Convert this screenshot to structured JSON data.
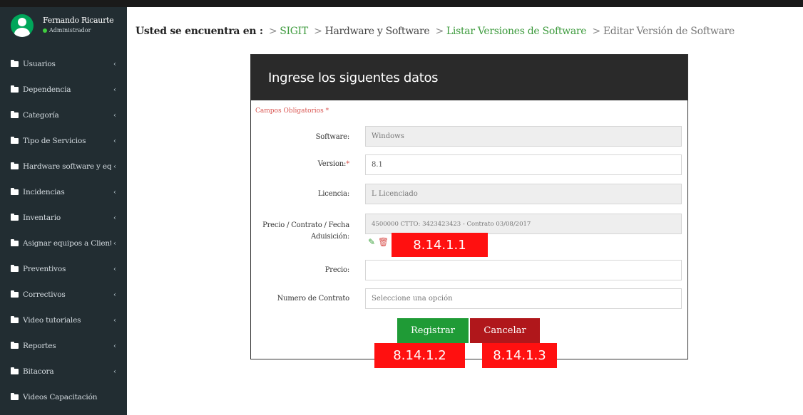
{
  "user": {
    "name": "Fernando Ricaurte",
    "role": "Administrador"
  },
  "sidebar": {
    "items": [
      {
        "label": "Usuarios"
      },
      {
        "label": "Dependencia"
      },
      {
        "label": "Categoría"
      },
      {
        "label": "Tipo de Servicios"
      },
      {
        "label": "Hardware software y equipo"
      },
      {
        "label": "Incidencias"
      },
      {
        "label": "Inventario"
      },
      {
        "label": "Asignar equipos a Clientes"
      },
      {
        "label": "Preventivos"
      },
      {
        "label": "Correctivos"
      },
      {
        "label": "Video tutoriales"
      },
      {
        "label": "Reportes"
      },
      {
        "label": "Bitacora"
      },
      {
        "label": "Videos Capacitación"
      }
    ],
    "chevron": "‹"
  },
  "breadcrumb": {
    "lead": "Usted se encuentra en :",
    "separator": ">",
    "items": [
      "SIGIT",
      "Hardware y Software",
      "Listar Versiones de Software",
      "Editar Versión de Software"
    ]
  },
  "form": {
    "title": "Ingrese los siguentes datos",
    "required_note": "Campos Obligatorios *",
    "required_mark": "*",
    "fields": [
      {
        "label": "Software:",
        "value": "Windows"
      },
      {
        "label": "Version:",
        "value": "8.1"
      },
      {
        "label": "Licencia:",
        "value": "L Licenciado"
      },
      {
        "label": "Precio / Contrato / Fecha Aduisición:",
        "value": "4500000 CTTO: 3423423423 - Contrato 03/08/2017"
      },
      {
        "label": "Precio:",
        "value": ""
      },
      {
        "label": "Numero de Contrato",
        "placeholder": "Seleccione una opción"
      }
    ],
    "edit_icon": "pencil-square",
    "trash_icon": "trash",
    "register_label": "Registrar",
    "cancel_label": "Cancelar"
  },
  "callouts": [
    "8.14.1.1",
    "8.14.1.2",
    "8.14.1.3"
  ],
  "colors": {
    "sidebar_bg": "#222d32",
    "panel_header_bg": "#2a2a2a",
    "register_green": "#1f9b36",
    "cancel_red": "#b0171b",
    "callout_red": "#ff1010",
    "link_green": "#3c9a3c"
  }
}
